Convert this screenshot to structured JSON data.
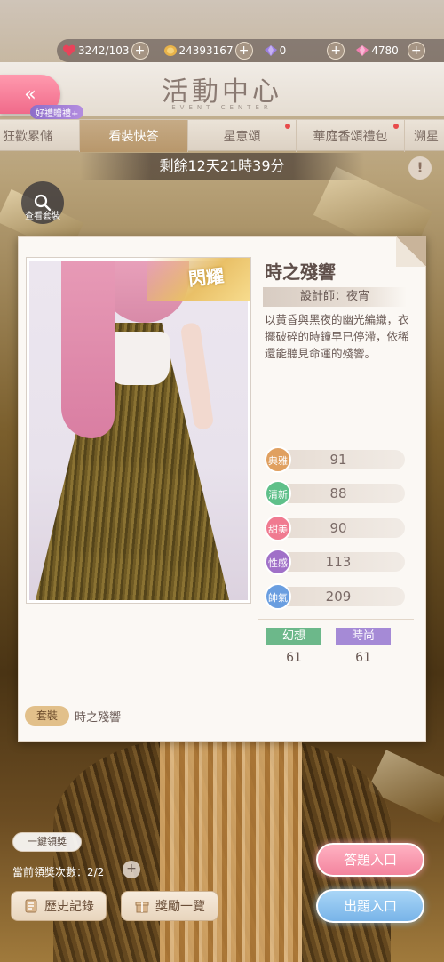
{
  "currencies": [
    {
      "icon": "heart-icon",
      "value": "3242/103",
      "color": "#e8435a"
    },
    {
      "icon": "coin-icon",
      "value": "24393167",
      "color": "#e8b34a"
    },
    {
      "icon": "gem-icon",
      "value": "0",
      "color": "#9b7fe0"
    },
    {
      "icon": "diamond-icon",
      "value": "4780",
      "color": "#f07fb0"
    }
  ],
  "header": {
    "title": "活動中心",
    "subtitle": "EVENT CENTER",
    "gift_tag": "好禮贈禮+",
    "back_icon": "double-chevron-left-icon"
  },
  "tabs": [
    {
      "label": "狂歡累儲",
      "active": false,
      "dot": false
    },
    {
      "label": "看裝快答",
      "active": true,
      "dot": false
    },
    {
      "label": "星意頌",
      "active": false,
      "dot": true
    },
    {
      "label": "華庭香頌禮包",
      "active": false,
      "dot": true
    },
    {
      "label": "溯星",
      "active": false,
      "dot": false
    }
  ],
  "timer": "剩餘12天21時39分",
  "view_outfit": "查看套裝",
  "card": {
    "badge": "閃耀",
    "name": "時之殘響",
    "designer": "設計師：夜宵",
    "description": "以黃昏與黑夜的幽光編織，衣擺破碎的時鐘早已停滯，依稀還能聽見命運的殘響。",
    "stats": [
      {
        "label": "典雅",
        "value": "91",
        "color": "#e0a060"
      },
      {
        "label": "清新",
        "value": "88",
        "color": "#5fc08a"
      },
      {
        "label": "甜美",
        "value": "90",
        "color": "#f07a90"
      },
      {
        "label": "性感",
        "value": "113",
        "color": "#a070c8"
      },
      {
        "label": "帥氣",
        "value": "209",
        "color": "#6a9ee0"
      }
    ],
    "styles": [
      {
        "label": "幻想",
        "value": "61",
        "color": "#6cb88a"
      },
      {
        "label": "時尚",
        "value": "61",
        "color": "#a58ad6"
      }
    ],
    "set_tag": "套裝",
    "set_name": "時之殘響"
  },
  "bottom": {
    "one_click": "一鍵領獎",
    "claim_count": "當前領獎次數：2/2",
    "history": "歷史記錄",
    "rewards": "獎勵一覽",
    "answer": "答題入口",
    "ask": "出題入口"
  }
}
